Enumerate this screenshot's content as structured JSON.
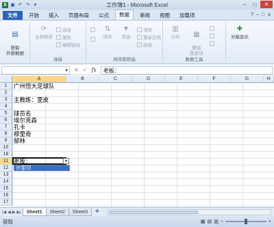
{
  "window": {
    "title": "工作簿1 - Microsoft Excel",
    "qat_icons": [
      "excel-logo-icon",
      "save-icon",
      "undo-icon",
      "redo-icon"
    ]
  },
  "tabs": [
    {
      "label": "文件"
    },
    {
      "label": "开始"
    },
    {
      "label": "插入"
    },
    {
      "label": "页面布局"
    },
    {
      "label": "公式"
    },
    {
      "label": "数据"
    },
    {
      "label": "审阅"
    },
    {
      "label": "视图"
    },
    {
      "label": "加载项"
    }
  ],
  "active_tab": "数据",
  "ribbon": {
    "groups": [
      {
        "label": ""
      },
      {
        "label": "连接"
      },
      {
        "label": "排序和筛选"
      },
      {
        "label": "数据工具"
      },
      {
        "label": ""
      }
    ],
    "get_external_data": "获取\n外部数据",
    "refresh_all": "全部刷新",
    "connections": "连接",
    "properties": "属性",
    "edit_links": "编辑链接",
    "sort": "排序",
    "filter": "筛选",
    "clear": "清除",
    "reapply": "重新应用",
    "advanced": "高级",
    "text_to_columns": "分列",
    "remove_duplicates": "删除\n重复项",
    "outline": "分级显示"
  },
  "formula_bar": {
    "name_box": "",
    "fx": "fx",
    "content": "老板："
  },
  "columns": [
    "A",
    "B",
    "C",
    "D",
    "E",
    "F",
    "G",
    "H"
  ],
  "active_column": "A",
  "rows": [
    "1",
    "2",
    "3",
    "4",
    "5",
    "6",
    "7",
    "8",
    "9",
    "10",
    "11",
    "12",
    "13",
    "14",
    "15",
    "16",
    "17",
    "18"
  ],
  "active_row": "11",
  "cells": [
    {
      "row": "1",
      "text": "广州恒大足球队"
    },
    {
      "row": "3",
      "text": "主教练：里皮"
    },
    {
      "row": "5",
      "text": "球员名"
    },
    {
      "row": "6",
      "text": "埃尔克森"
    },
    {
      "row": "7",
      "text": "孔卡"
    },
    {
      "row": "8",
      "text": "穆里奇"
    },
    {
      "row": "9",
      "text": "郜林"
    },
    {
      "row": "11",
      "text": "老板："
    }
  ],
  "autocomplete_option": "许家印",
  "sheets": [
    {
      "label": "Sheet1"
    },
    {
      "label": "Sheet2"
    },
    {
      "label": "Sheet3"
    }
  ],
  "active_sheet": "Sheet1",
  "status": {
    "mode": "获取"
  }
}
